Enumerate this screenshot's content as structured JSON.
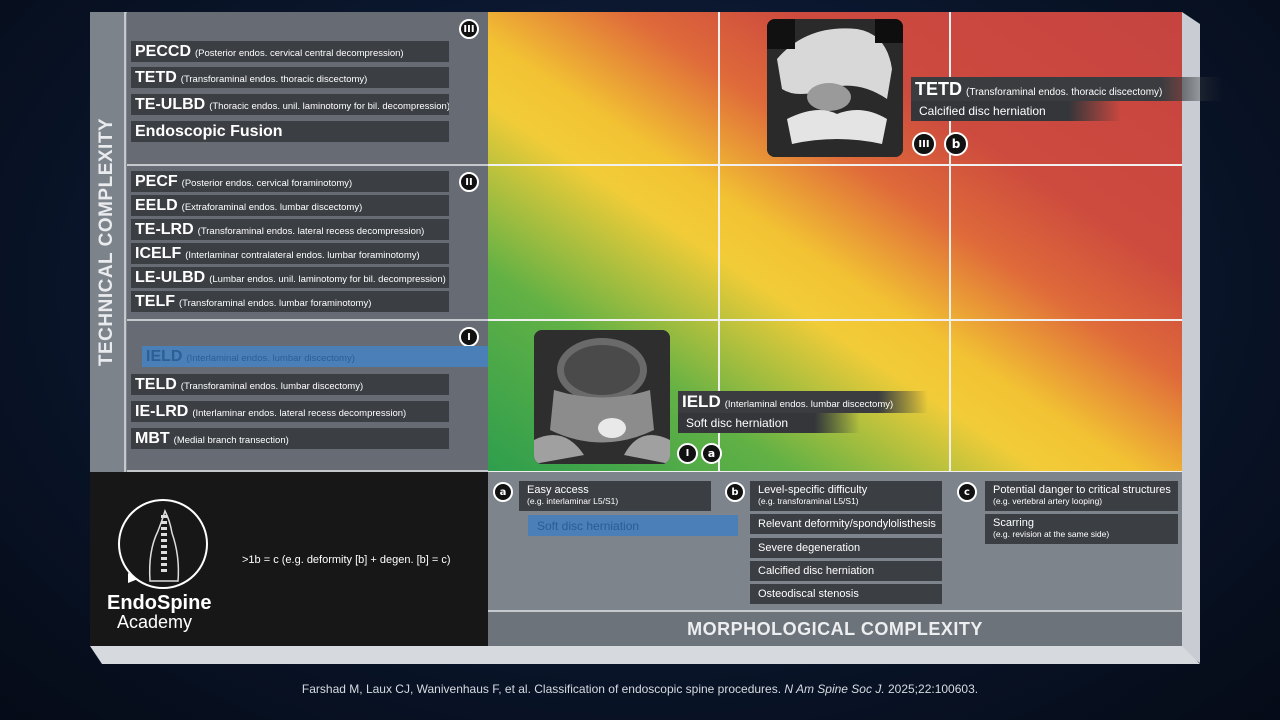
{
  "axes": {
    "vertical": "TECHNICAL COMPLEXITY",
    "horizontal": "MORPHOLOGICAL COMPLEXITY"
  },
  "tiers": [
    {
      "badge": "III",
      "procedures": [
        {
          "abbr": "PECCD",
          "full": "(Posterior endos. cervical central decompression)"
        },
        {
          "abbr": "TETD",
          "full": "(Transforaminal endos. thoracic discectomy)"
        },
        {
          "abbr": "TE-ULBD",
          "full": "(Thoracic endos. unil. laminotomy for bil. decompression)"
        },
        {
          "abbr": "Endoscopic Fusion",
          "full": ""
        }
      ]
    },
    {
      "badge": "II",
      "procedures": [
        {
          "abbr": "PECF",
          "full": "(Posterior endos. cervical foraminotomy)"
        },
        {
          "abbr": "EELD",
          "full": "(Extraforaminal endos. lumbar discectomy)"
        },
        {
          "abbr": "TE-LRD",
          "full": "(Transforaminal endos. lateral recess decompression)"
        },
        {
          "abbr": "ICELF",
          "full": "(Interlaminar contralateral endos. lumbar foraminotomy)"
        },
        {
          "abbr": "LE-ULBD",
          "full": "(Lumbar endos. unil. laminotomy for bil. decompression)"
        },
        {
          "abbr": "TELF",
          "full": "(Transforaminal endos. lumbar foraminotomy)"
        }
      ]
    },
    {
      "badge": "I",
      "procedures": [
        {
          "abbr": "IELD",
          "full": "(Interlaminal endos. lumbar discectomy)"
        },
        {
          "abbr": "TELD",
          "full": "(Transforaminal endos. lumbar discectomy)"
        },
        {
          "abbr": "IE-LRD",
          "full": "(Interlaminar endos. lateral recess decompression)"
        },
        {
          "abbr": "MBT",
          "full": "(Medial branch transection)"
        }
      ]
    }
  ],
  "callouts": {
    "upper": {
      "abbr": "TETD",
      "full": "(Transforaminal endos. thoracic discectomy)",
      "sub": "Calcified disc herniation",
      "badges": [
        "III",
        "b"
      ]
    },
    "lower": {
      "abbr": "IELD",
      "full": "(Interlaminal endos. lumbar discectomy)",
      "sub": "Soft disc herniation",
      "badges": [
        "I",
        "a"
      ]
    }
  },
  "criteria": {
    "a": {
      "badge": "a",
      "items": [
        {
          "main": "Easy access",
          "eg": "(e.g. interlaminar L5/S1)"
        },
        {
          "main": "Soft disc herniation",
          "eg": ""
        }
      ]
    },
    "b": {
      "badge": "b",
      "items": [
        {
          "main": "Level-specific difficulty",
          "eg": "(e.g. transforaminal L5/S1)"
        },
        {
          "main": "Relevant deformity/spondylolisthesis",
          "eg": ""
        },
        {
          "main": "Severe degeneration",
          "eg": ""
        },
        {
          "main": "Calcified disc herniation",
          "eg": ""
        },
        {
          "main": "Osteodiscal stenosis",
          "eg": ""
        }
      ]
    },
    "c": {
      "badge": "c",
      "items": [
        {
          "main": "Potential danger to critical structures",
          "eg": "(e.g. vertebral artery looping)"
        },
        {
          "main": "Scarring",
          "eg": "(e.g. revision at the same side)"
        }
      ]
    }
  },
  "logo": {
    "line1": "EndoSpine",
    "line2": "Academy"
  },
  "formula": ">1b = c (e.g. deformity [b] + degen. [b] = c)",
  "citation": {
    "text": "Farshad M, Laux CJ, Wanivenhaus F, et al. Classification of endoscopic spine procedures. ",
    "journal": "N Am Spine Soc J.",
    "tail": " 2025;22:100603."
  },
  "colors": {
    "low": "#2e9e4d",
    "mid": "#f2cc38",
    "high": "#c64440",
    "highlight": "#4a7fb8"
  }
}
